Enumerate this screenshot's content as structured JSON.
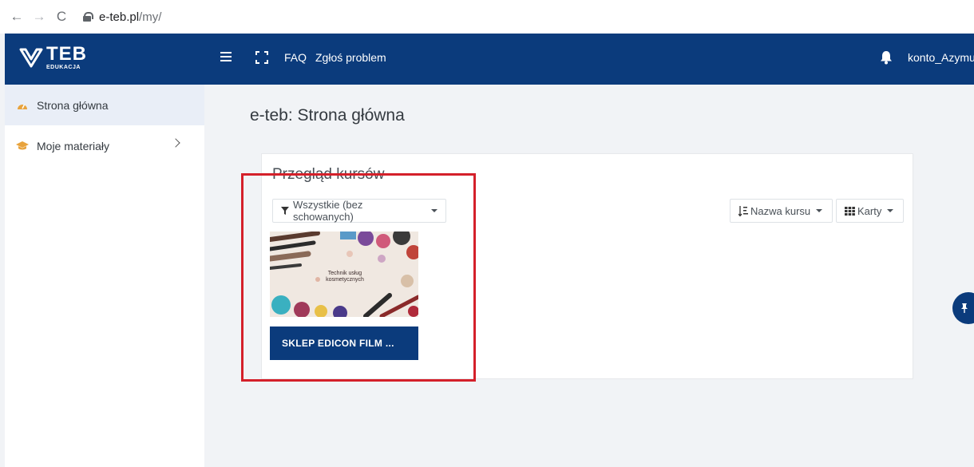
{
  "browser": {
    "url_host": "e-teb.pl",
    "url_path": "/my/",
    "back_glyph": "←",
    "forward_glyph": "→",
    "reload_glyph": "C"
  },
  "navbar": {
    "logo_main": "TEB",
    "logo_sub": "EDUKACJA",
    "faq": "FAQ",
    "report": "Zgłoś problem",
    "user": "konto_Azymu"
  },
  "sidebar": {
    "items": [
      {
        "label": "Strona główna",
        "icon": "dashboard-icon"
      },
      {
        "label": "Moje materiały",
        "icon": "graduation-cap-icon"
      }
    ]
  },
  "main": {
    "page_title": "e-teb: Strona główna",
    "course_overview": {
      "title": "Przegląd kursów",
      "filter": "Wszystkie (bez schowanych)",
      "sort": "Nazwa kursu",
      "view": "Karty",
      "courses": [
        {
          "name": "SKLEP EDICON FILM ...",
          "image_text": "Technik usług kosmetycznych"
        }
      ]
    }
  },
  "colors": {
    "navbar": "#0b3b7c",
    "highlight": "#d4202a",
    "sidebar_active": "#e9eef7"
  }
}
